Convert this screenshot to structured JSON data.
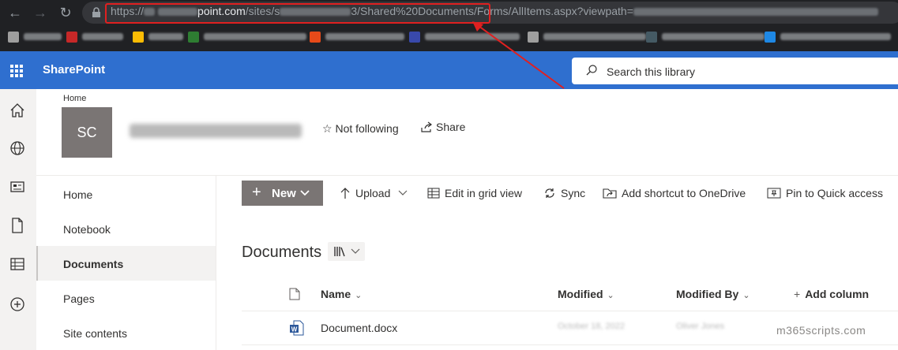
{
  "browser": {
    "url_prefix": "https://",
    "url_host_visible": "point.com",
    "url_path_1": "/sites/s",
    "url_path_2": "3/Shared%20Documents",
    "url_path_3": "/Forms/AllItems.aspx?viewpath="
  },
  "suite": {
    "brand": "SharePoint",
    "search_placeholder": "Search this library"
  },
  "site": {
    "breadcrumb": "Home",
    "logo_initials": "SC",
    "follow_label": "Not following",
    "share_label": "Share"
  },
  "left_nav": {
    "items": [
      {
        "label": "Home"
      },
      {
        "label": "Notebook"
      },
      {
        "label": "Documents"
      },
      {
        "label": "Pages"
      },
      {
        "label": "Site contents"
      }
    ]
  },
  "command_bar": {
    "new_label": "New",
    "upload_label": "Upload",
    "grid_label": "Edit in grid view",
    "sync_label": "Sync",
    "shortcut_label": "Add shortcut to OneDrive",
    "pin_label": "Pin to Quick access"
  },
  "library": {
    "title": "Documents",
    "columns": {
      "name": "Name",
      "modified": "Modified",
      "modified_by": "Modified By",
      "add_column": "Add column"
    },
    "rows": [
      {
        "name": "Document.docx",
        "modified": "October 18, 2022",
        "modified_by": "Oliver Jones"
      }
    ]
  },
  "watermark": "m365scripts.com",
  "colors": {
    "suite_bar": "#2f6fcf",
    "highlight": "#e02020",
    "new_button": "#7a7574"
  }
}
